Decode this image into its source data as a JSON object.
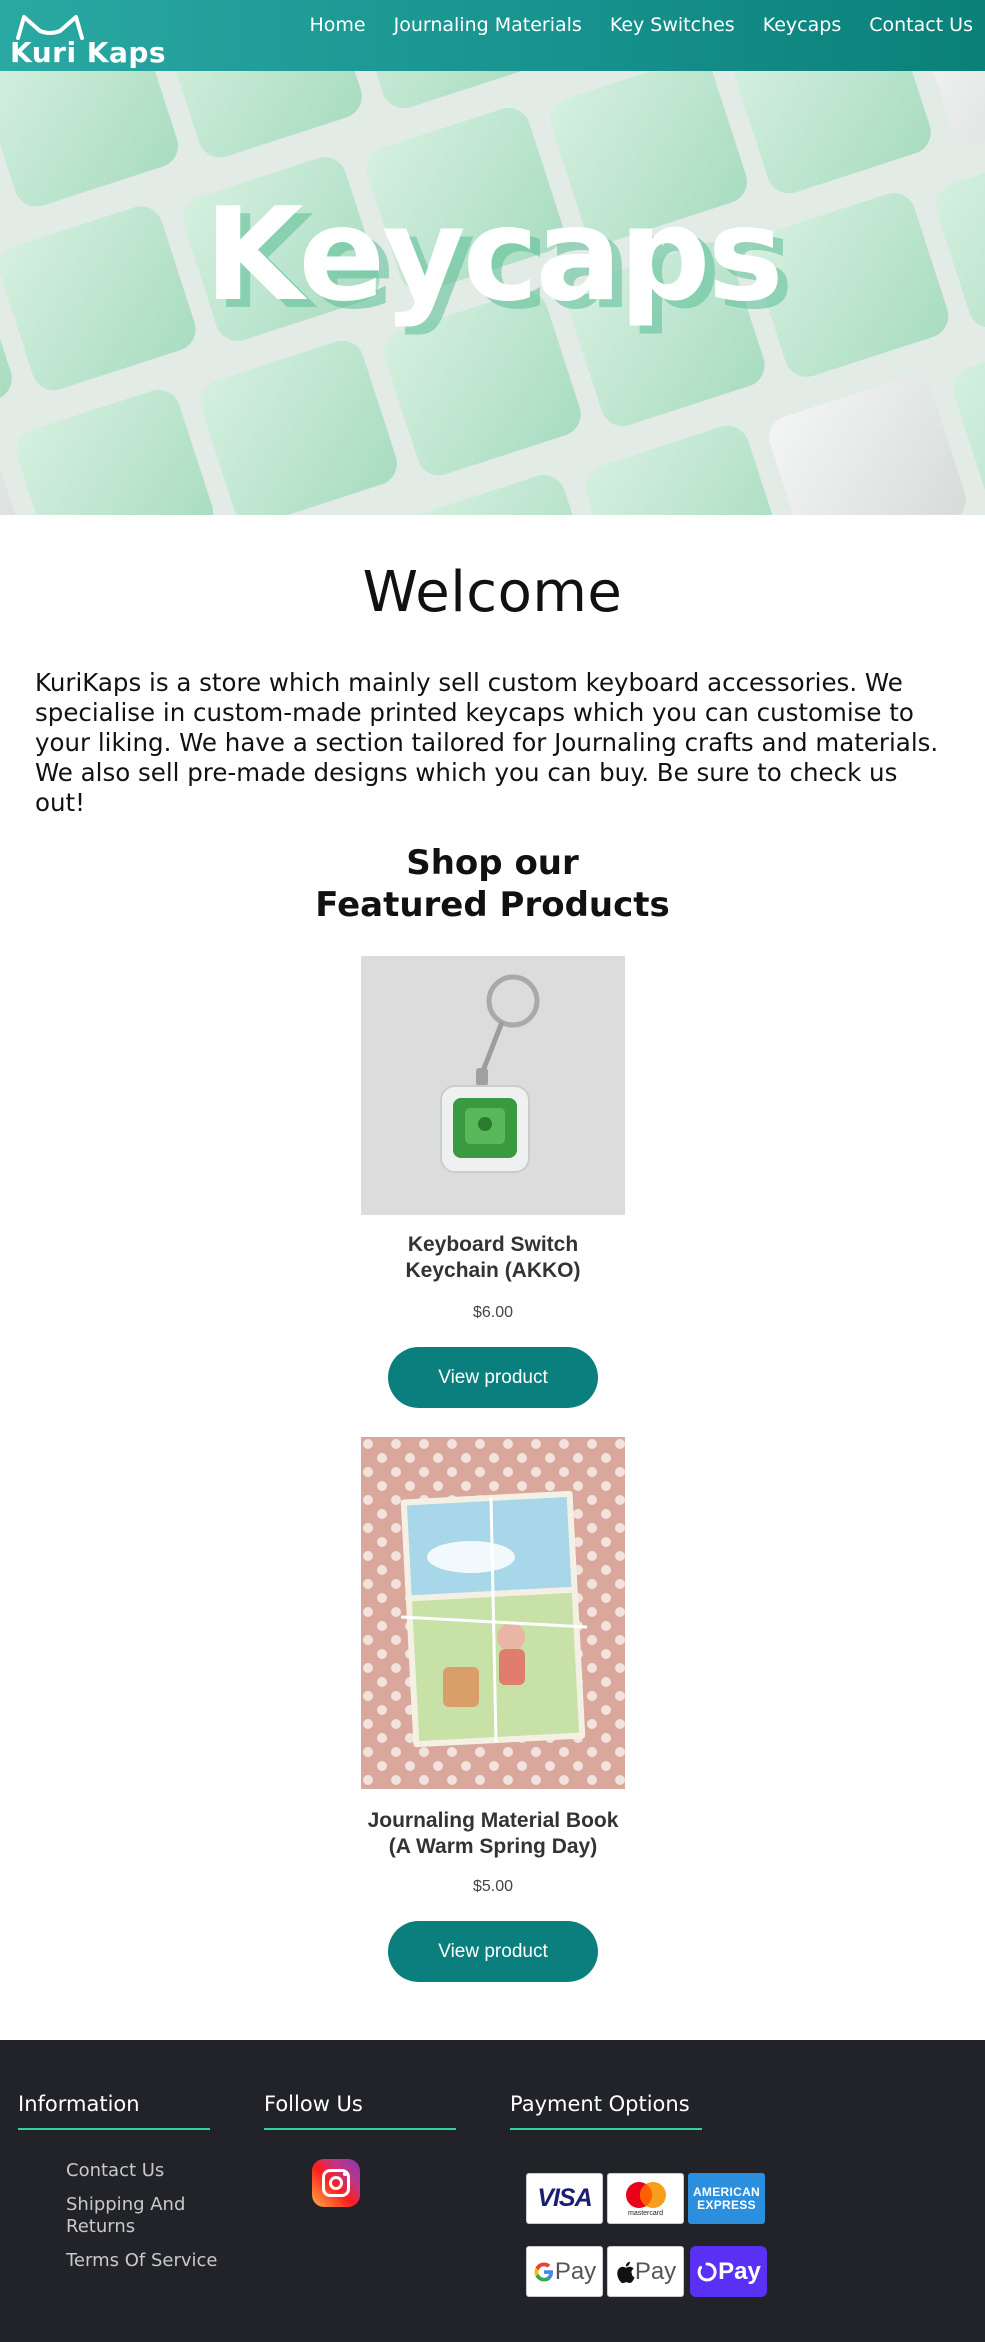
{
  "header": {
    "logo_text": "Kuri Kaps",
    "nav": [
      "Home",
      "Journaling Materials",
      "Key Switches",
      "Keycaps",
      "Contact Us"
    ]
  },
  "hero": {
    "title": "Keycaps"
  },
  "welcome": {
    "title": "Welcome",
    "text": "KuriKaps is a store which mainly sell custom keyboard accessories. We specialise in custom-made printed keycaps which you can customise to your liking. We have a section tailored for Journaling crafts and materials. We also sell pre-made designs which you can buy. Be sure to check us out!"
  },
  "featured": {
    "title_line1": "Shop our",
    "title_line2": "Featured Products"
  },
  "products": [
    {
      "name_line1": "Keyboard Switch",
      "name_line2": "Keychain (AKKO)",
      "price": "$6.00",
      "button": "View product"
    },
    {
      "name_line1": "Journaling Material Book",
      "name_line2": "(A Warm Spring Day)",
      "price": "$5.00",
      "button": "View product"
    }
  ],
  "footer": {
    "information": {
      "title": "Information",
      "links": [
        "Contact Us",
        "Shipping And Returns",
        "Terms Of Service"
      ]
    },
    "follow": {
      "title": "Follow Us",
      "icon": "instagram-icon"
    },
    "payment": {
      "title": "Payment Options",
      "methods": [
        {
          "label": "VISA"
        },
        {
          "label": "mastercard"
        },
        {
          "label": "AMERICAN EXPRESS"
        },
        {
          "label": "Pay"
        },
        {
          "label": "Pay"
        },
        {
          "label": "Pay"
        }
      ]
    }
  },
  "colors": {
    "brand_teal": "#0b7f7e",
    "footer_bg": "#222328",
    "footer_accent": "#2ed39b"
  }
}
